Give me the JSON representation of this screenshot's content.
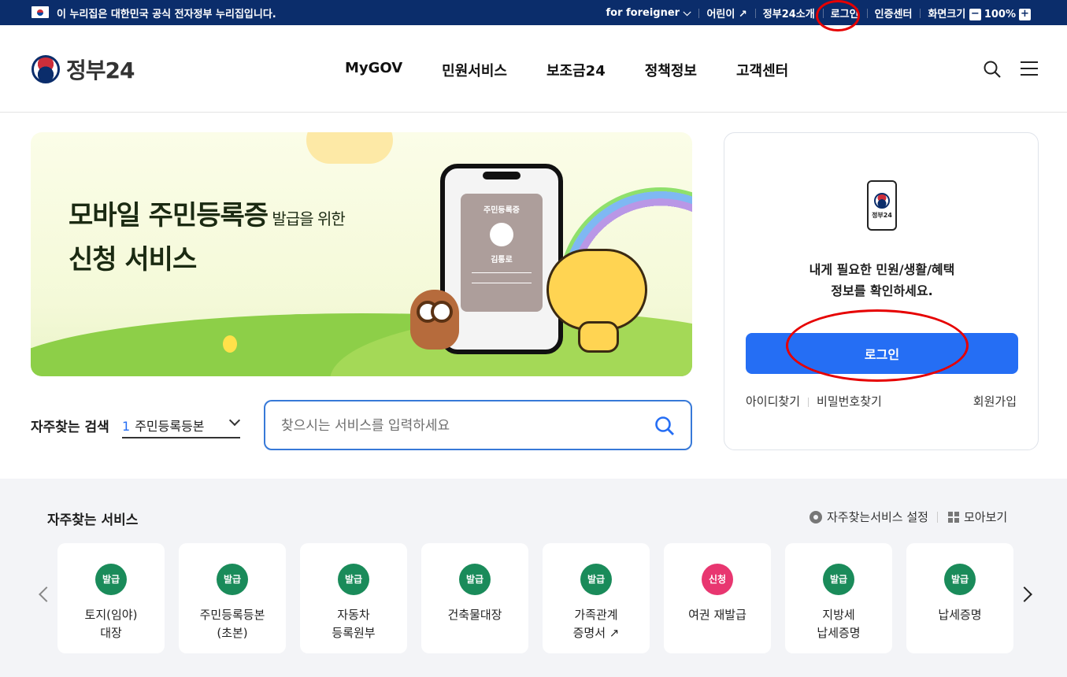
{
  "topbar": {
    "notice": "이 누리집은 대한민국 공식 전자정부 누리집입니다.",
    "links": [
      "for foreigner ⌵",
      "어린이 ↗",
      "정부24소개",
      "로그인",
      "인증센터",
      "화면크기"
    ],
    "zoom_minus": "−",
    "zoom_value": "100%",
    "zoom_plus": "+"
  },
  "header": {
    "logo_text": "정부24",
    "nav": [
      "MyGOV",
      "민원서비스",
      "보조금24",
      "정책정보",
      "고객센터"
    ]
  },
  "banner": {
    "title_line1": "모바일 주민등록증",
    "title_small": " 발급을 위한",
    "title_line2": "신청 서비스",
    "card_title": "주민등록증",
    "card_name": "김통로"
  },
  "search": {
    "freq_label": "자주찾는 검색",
    "freq_num": "1",
    "freq_value": "주민등록등본",
    "placeholder": "찾으시는 서비스를 입력하세요"
  },
  "login_card": {
    "phone_label": "정부24",
    "message_line1": "내게 필요한 민원/생활/혜택",
    "message_line2": "정보를 확인하세요.",
    "login_button": "로그인",
    "find_id": "아이디찾기",
    "find_pw": "비밀번호찾기",
    "join": "회원가입"
  },
  "services": {
    "title": "자주찾는 서비스",
    "settings_label": "자주찾는서비스 설정",
    "view_all_label": "모아보기",
    "cards": [
      {
        "badge": "발급",
        "name": "토지(임야)\n대장"
      },
      {
        "badge": "발급",
        "name": "주민등록등본\n(초본)"
      },
      {
        "badge": "발급",
        "name": "자동차\n등록원부"
      },
      {
        "badge": "발급",
        "name": "건축물대장"
      },
      {
        "badge": "발급",
        "name": "가족관계\n증명서 ↗"
      },
      {
        "badge": "신청",
        "name": "여권 재발급"
      },
      {
        "badge": "발급",
        "name": "지방세\n납세증명"
      },
      {
        "badge": "발급",
        "name": "납세증명"
      }
    ]
  },
  "colors": {
    "brand_navy": "#0b2d6b",
    "primary_blue": "#256ef4",
    "issue_green": "#1a8b5a",
    "apply_pink": "#e83670",
    "annotation_red": "#e60000"
  }
}
